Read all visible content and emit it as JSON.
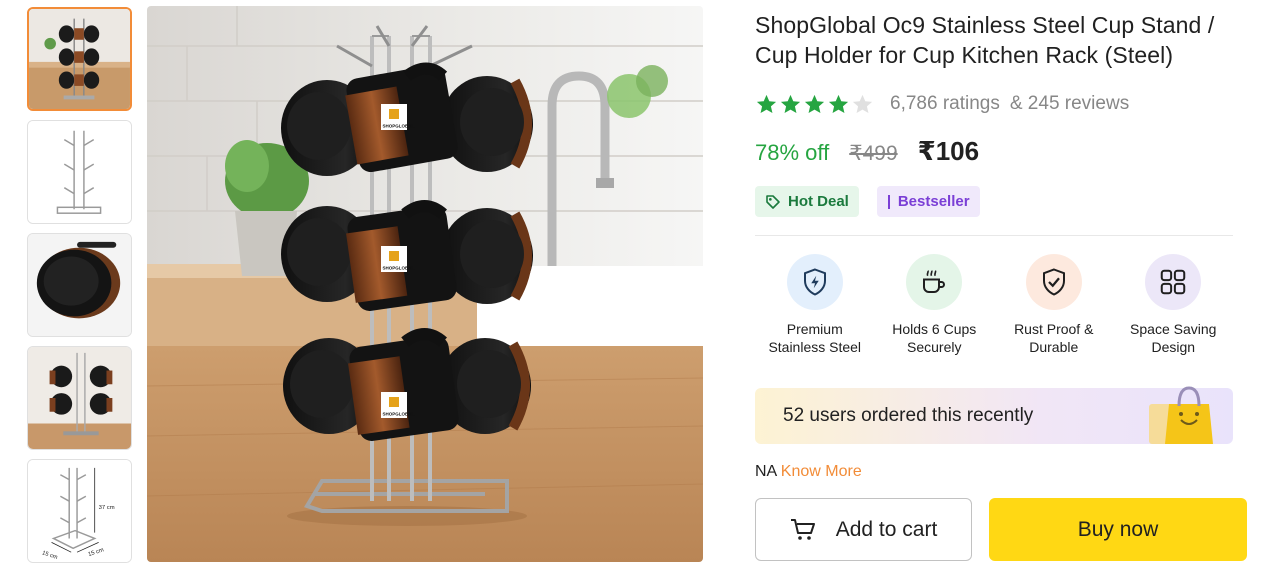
{
  "gallery": {
    "thumbnails": [
      {
        "icon": "cup-rack-with-cups-image",
        "selected": true
      },
      {
        "icon": "empty-rack-image",
        "selected": false
      },
      {
        "icon": "single-cup-image",
        "selected": false
      },
      {
        "icon": "rack-with-cups-side-image",
        "selected": false
      },
      {
        "icon": "rack-dimensions-image",
        "selected": false
      }
    ],
    "dimension_labels": {
      "height": "37 cm",
      "width": "15 cm",
      "depth": "15 cm"
    },
    "cup_brand_label": "SHOPGLOBAL"
  },
  "product": {
    "title": "ShopGlobal Oc9 Stainless Steel Cup Stand / Cup Holder for Cup Kitchen Rack (Steel)",
    "rating": {
      "stars": 4,
      "ratings_text": "6,786 ratings",
      "reviews_text": "& 245 reviews",
      "star_color": "#26a541"
    },
    "pricing": {
      "discount": "78% off",
      "mrp": "₹499",
      "price": "₹106"
    },
    "badges": [
      {
        "label": "Hot Deal",
        "icon": "tag-icon"
      },
      {
        "label": "Bestseller",
        "icon": "bar-icon"
      }
    ],
    "features": [
      {
        "line1": "Premium",
        "line2": "Stainless Steel",
        "icon": "shield-bolt-icon",
        "bg": "#e3effc"
      },
      {
        "line1": "Holds 6 Cups",
        "line2": "Securely",
        "icon": "cup-icon",
        "bg": "#e4f5e8"
      },
      {
        "line1": "Rust Proof &",
        "line2": "Durable",
        "icon": "shield-check-icon",
        "bg": "#fde9de"
      },
      {
        "line1": "Space Saving",
        "line2": "Design",
        "icon": "grid-icon",
        "bg": "#ece7f8"
      }
    ],
    "promo_text": "52 users ordered this recently",
    "na_text": "NA",
    "know_more": "Know More"
  },
  "actions": {
    "add_to_cart": "Add to cart",
    "buy_now": "Buy now"
  }
}
